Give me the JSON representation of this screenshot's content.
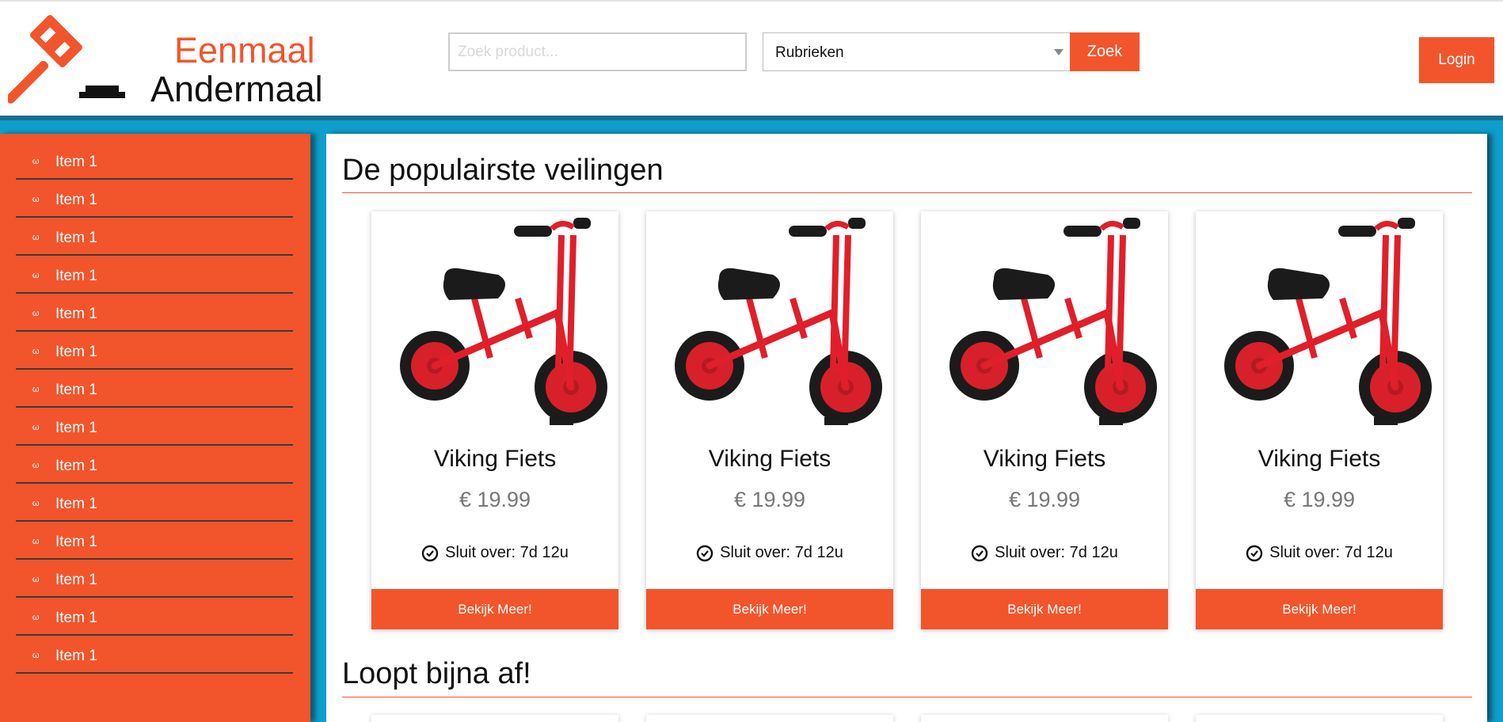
{
  "brand": {
    "line1": "Eenmaal",
    "line2": "Andermaal"
  },
  "search": {
    "placeholder": "Zoek product...",
    "button_label": "Zoek"
  },
  "category_select": {
    "selected": "Rubrieken"
  },
  "header": {
    "login_label": "Login"
  },
  "sidebar": {
    "bullet": "ω",
    "items": [
      {
        "label": "Item 1"
      },
      {
        "label": "Item 1"
      },
      {
        "label": "Item 1"
      },
      {
        "label": "Item 1"
      },
      {
        "label": "Item 1"
      },
      {
        "label": "Item 1"
      },
      {
        "label": "Item 1"
      },
      {
        "label": "Item 1"
      },
      {
        "label": "Item 1"
      },
      {
        "label": "Item 1"
      },
      {
        "label": "Item 1"
      },
      {
        "label": "Item 1"
      },
      {
        "label": "Item 1"
      },
      {
        "label": "Item 1"
      }
    ]
  },
  "sections": {
    "popular_title": "De populairste veilingen",
    "ending_title": "Loopt bijna af!"
  },
  "cards": [
    {
      "title": "Viking Fiets",
      "price": "€ 19.99",
      "timer": "Sluit over: 7d 12u",
      "button": "Bekijk Meer!"
    },
    {
      "title": "Viking Fiets",
      "price": "€ 19.99",
      "timer": "Sluit over: 7d 12u",
      "button": "Bekijk Meer!"
    },
    {
      "title": "Viking Fiets",
      "price": "€ 19.99",
      "timer": "Sluit over: 7d 12u",
      "button": "Bekijk Meer!"
    },
    {
      "title": "Viking Fiets",
      "price": "€ 19.99",
      "timer": "Sluit over: 7d 12u",
      "button": "Bekijk Meer!"
    }
  ],
  "colors": {
    "accent": "#f2552c",
    "background": "#0f9ecb",
    "header_bar": "#1b6d8f"
  },
  "icons": {
    "logo": "gavel-icon",
    "timer": "clock-icon",
    "dropdown": "caret-down-icon",
    "bullet": "omega-bullet-icon"
  }
}
